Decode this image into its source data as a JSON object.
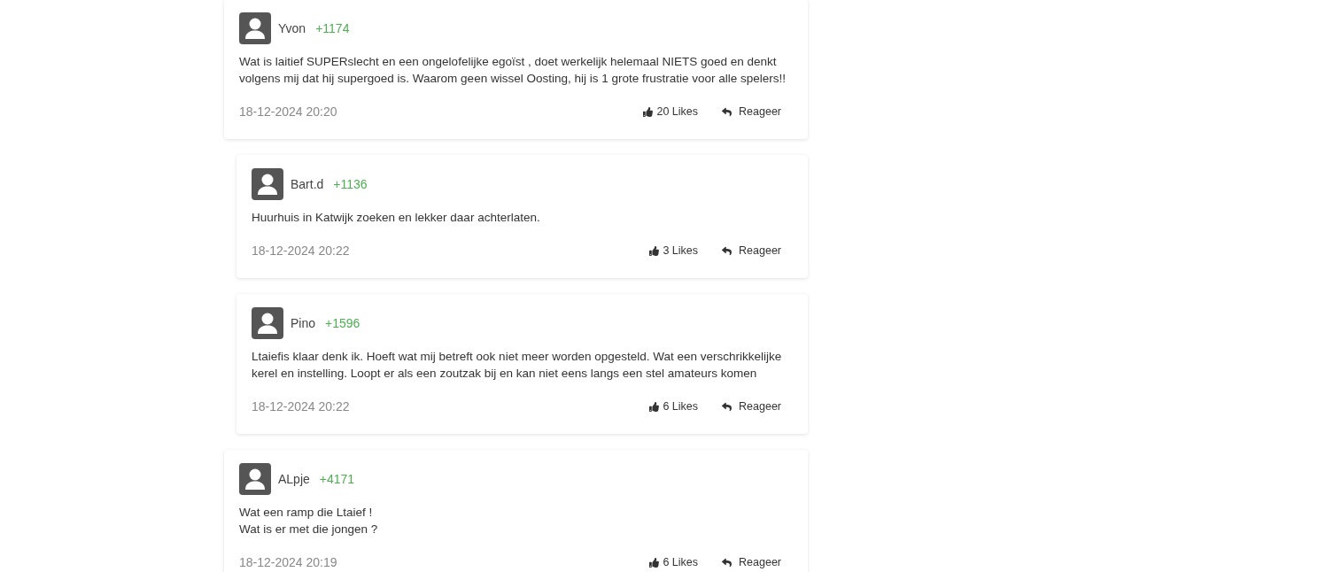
{
  "comments": [
    {
      "author": "Yvon",
      "score": "+1174",
      "text": "Wat is laitief SUPERslecht en een ongelofelijke egoïst , doet werkelijk helemaal NIETS goed en denkt volgens mij dat hij supergoed is. Waarom geen wissel Oosting, hij is 1 grote frustratie voor alle spelers!!",
      "date": "18-12-2024 20:20",
      "likes": "20 Likes",
      "reply": "Reageer",
      "replies": [
        {
          "author": "Bart.d",
          "score": "+1136",
          "text": "Huurhuis in Katwijk zoeken en lekker daar achterlaten.",
          "date": "18-12-2024 20:22",
          "likes": "3 Likes",
          "reply": "Reageer"
        },
        {
          "author": "Pino",
          "score": "+1596",
          "text": "Ltaiefis klaar denk ik. Hoeft wat mij betreft ook niet meer worden opgesteld. Wat een verschrikkelijke kerel en instelling. Loopt er als een zoutzak bij en kan niet eens langs een stel amateurs komen",
          "date": "18-12-2024 20:22",
          "likes": "6 Likes",
          "reply": "Reageer"
        }
      ]
    },
    {
      "author": "ALpje",
      "score": "+4171",
      "text": "Wat een ramp die Ltaief !\nWat is er met die jongen ?",
      "date": "18-12-2024 20:19",
      "likes": "6 Likes",
      "reply": "Reageer"
    }
  ]
}
